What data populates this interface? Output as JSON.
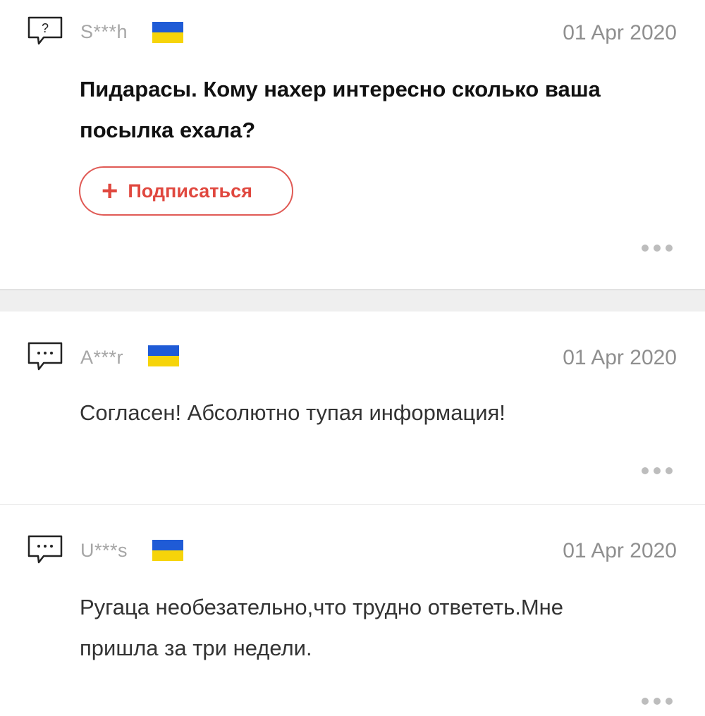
{
  "posts": [
    {
      "type": "question",
      "icon": "question-bubble-icon",
      "username": "S***h",
      "flag": {
        "country": "Ukraine",
        "top_color": "#1f5bd6",
        "bottom_color": "#f6d40a"
      },
      "date": "01 Apr 2020",
      "text": "Пидарасы. Кому нахер интересно сколько ваша посылка ехала?",
      "subscribe": {
        "icon": "plus-icon",
        "label": "Подписаться"
      },
      "more_icon": "more-dots-icon"
    },
    {
      "type": "answer",
      "icon": "ellipsis-bubble-icon",
      "username": "A***r",
      "flag": {
        "country": "Ukraine",
        "top_color": "#1f5bd6",
        "bottom_color": "#f6d40a"
      },
      "date": "01 Apr 2020",
      "text": "Согласен! Абсолютно тупая информация!",
      "more_icon": "more-dots-icon"
    },
    {
      "type": "answer",
      "icon": "ellipsis-bubble-icon",
      "username": "U***s",
      "flag": {
        "country": "Ukraine",
        "top_color": "#1f5bd6",
        "bottom_color": "#f6d40a"
      },
      "date": "01 Apr 2020",
      "text": "Ругаца необезательно,что трудно ответеть.Мне пришла  за три недели.",
      "more_icon": "more-dots-icon"
    }
  ],
  "colors": {
    "accent": "#e0483f",
    "muted": "#a6a6a6",
    "divider": "#efefef"
  }
}
